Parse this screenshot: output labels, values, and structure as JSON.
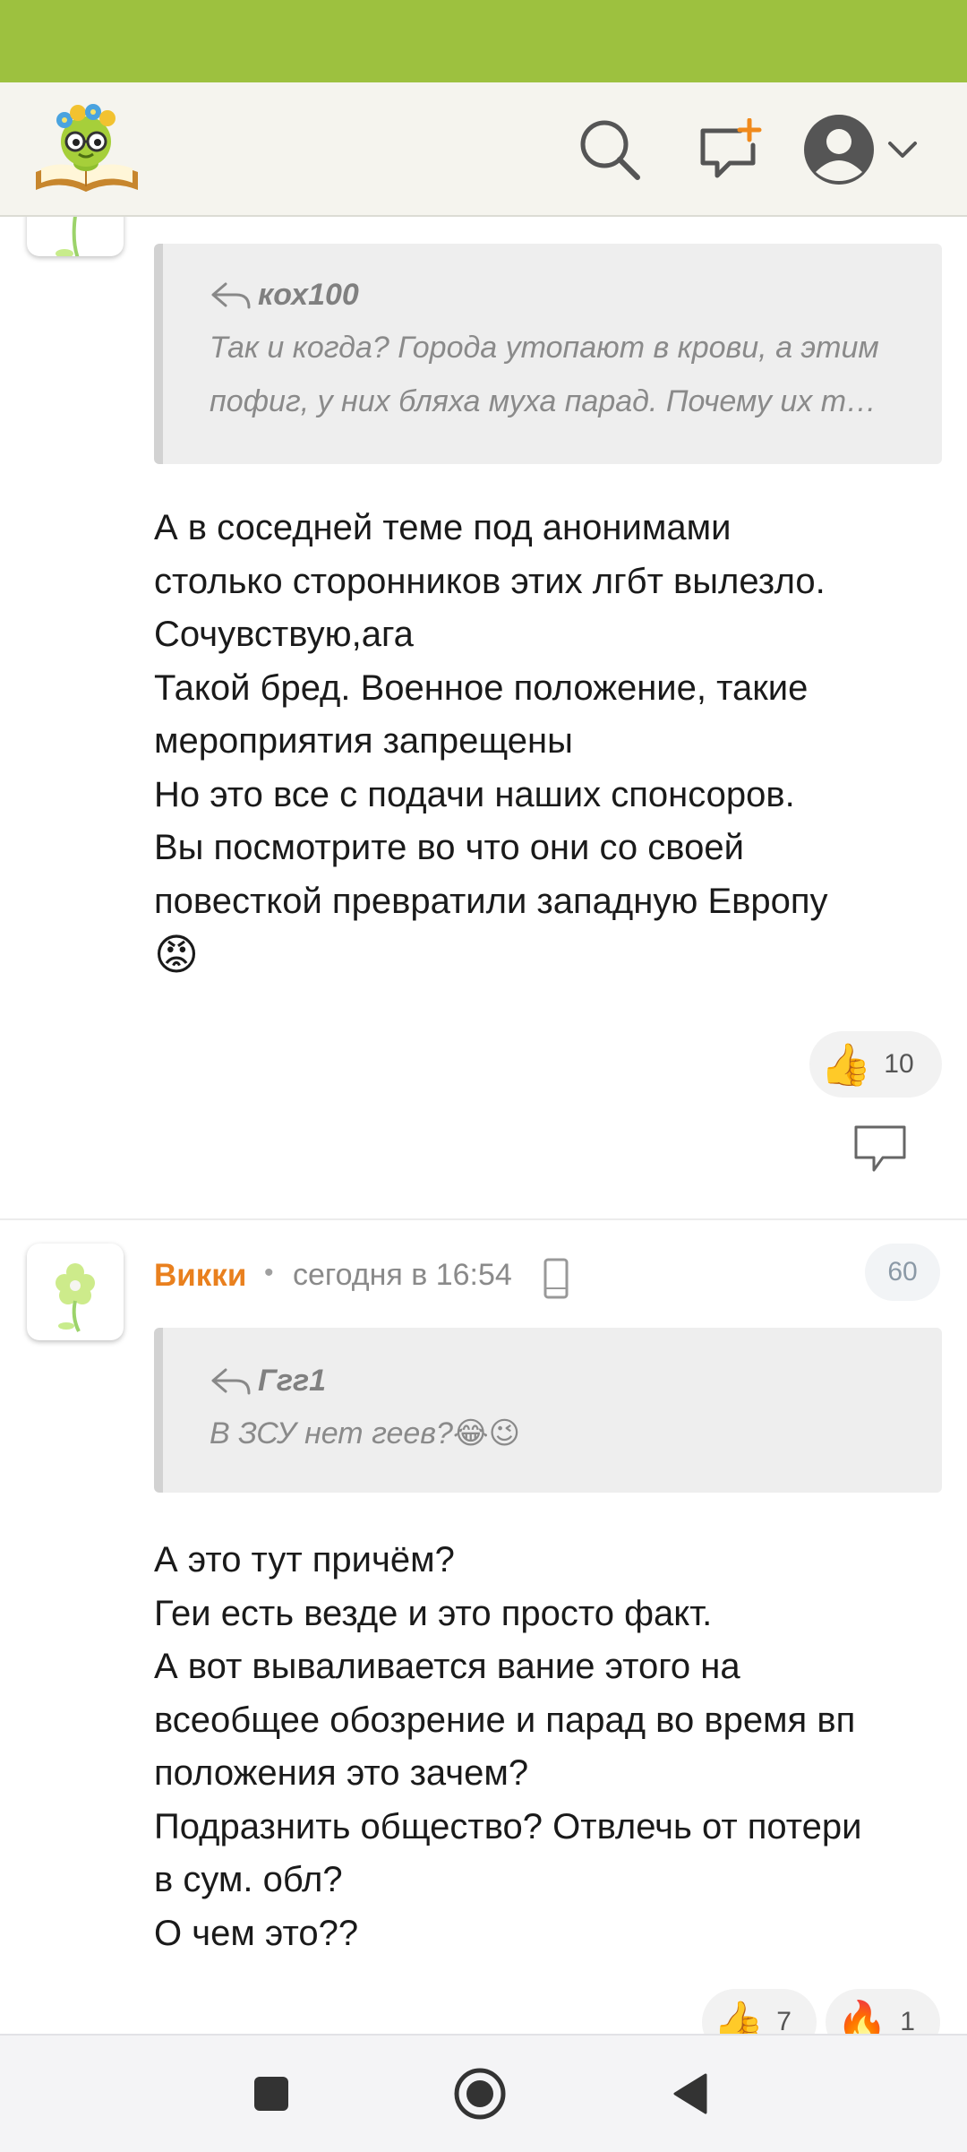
{
  "header": {
    "logo": "site-logo",
    "icons": [
      "search-icon",
      "new-message-icon",
      "user-avatar-icon",
      "chevron-down-icon"
    ]
  },
  "comments": [
    {
      "quote": {
        "author": "кох100",
        "text": "Так и когда? Города утопают в крови, а этим пофиг, у них бляха муха парад. Почему их т…"
      },
      "text": "А в соседней теме под анонимами\nстолько сторонников этих лгбт вылезло.\nСочувствую,ага\nТакой бред. Военное положение, такие\nмероприятия запрещены\nНо это все с подачи наших спонсоров.\nВы посмотрите во что они со своей\nповесткой превратили западную Европу",
      "emoji": "😡",
      "reactions": [
        {
          "icon": "👍",
          "count": "10"
        }
      ]
    },
    {
      "author": "Викки",
      "dot": "•",
      "time": "сегодня в 16:54",
      "rating": "60",
      "quote": {
        "author": "Ггг1",
        "text": "В ЗСУ нет геев?😂😉"
      },
      "text": "А это тут причём?\nГеи есть везде и это просто факт.\nА вот вываливается вание этого на\nвсеобщее обозрение и парад во время вп\nположения это зачем?\nПодразнить общество? Отвлечь от потери\nв сум. обл?\nО чем это??",
      "reactions": [
        {
          "icon": "👍",
          "count": "7"
        },
        {
          "icon": "🔥",
          "count": "1"
        }
      ]
    }
  ],
  "colors": {
    "status_bar": "#9dc13f",
    "header_bg": "#f5f4ee",
    "author_name": "#e9801e",
    "quote_bg": "#eeeeee"
  },
  "navigation": [
    "square-recents-icon",
    "circle-home-icon",
    "triangle-back-icon"
  ]
}
